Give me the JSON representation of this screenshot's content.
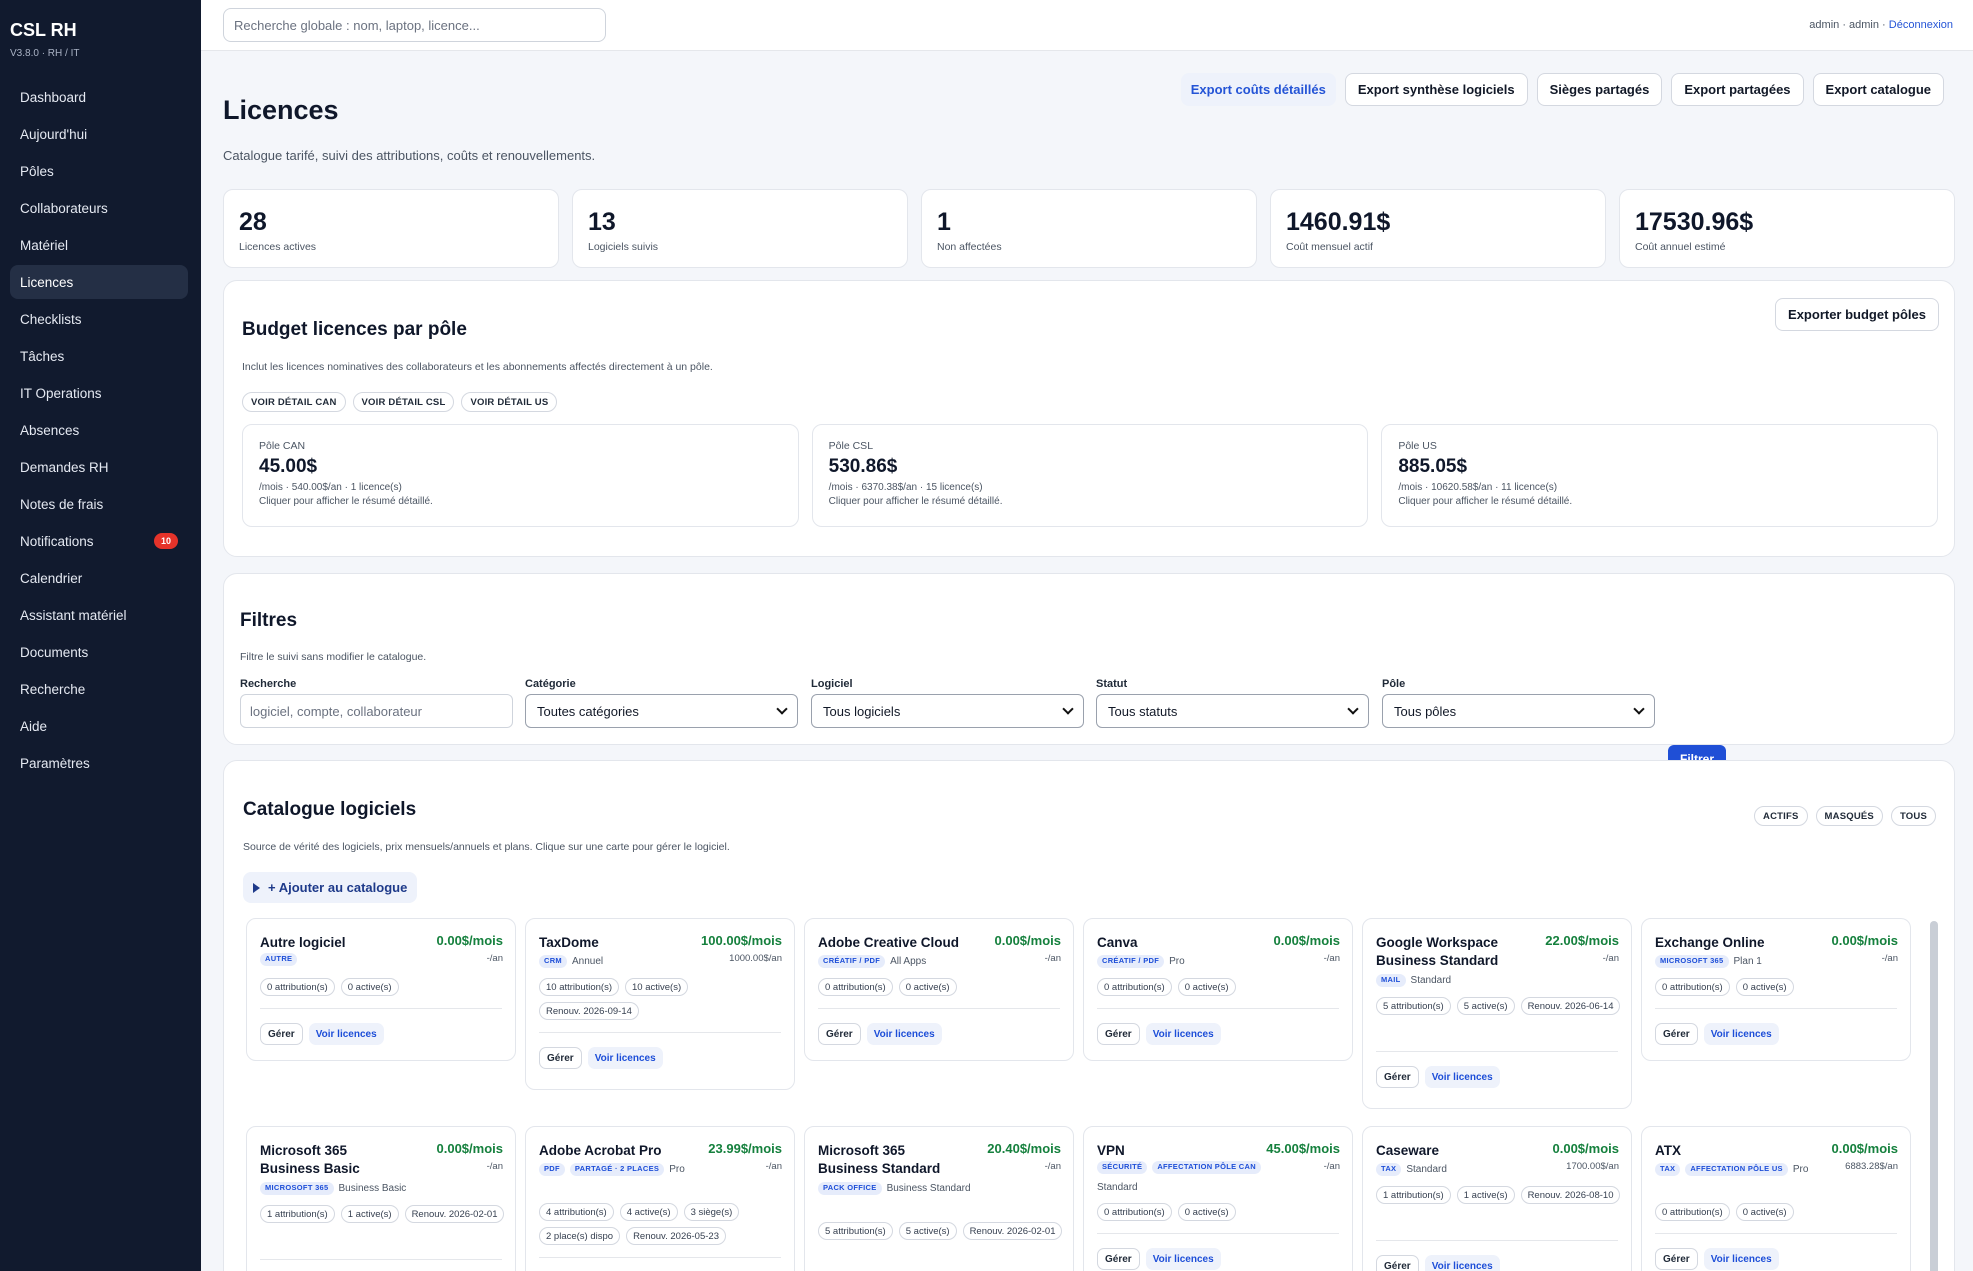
{
  "app": {
    "name": "CSL RH",
    "version": "V3.8.0 · RH / IT"
  },
  "sidebar": {
    "items": [
      {
        "label": "Dashboard"
      },
      {
        "label": "Aujourd'hui"
      },
      {
        "label": "Pôles"
      },
      {
        "label": "Collaborateurs"
      },
      {
        "label": "Matériel"
      },
      {
        "label": "Licences",
        "active": true
      },
      {
        "label": "Checklists"
      },
      {
        "label": "Tâches"
      },
      {
        "label": "IT Operations"
      },
      {
        "label": "Absences"
      },
      {
        "label": "Demandes RH"
      },
      {
        "label": "Notes de frais"
      },
      {
        "label": "Notifications",
        "badge": "10"
      },
      {
        "label": "Calendrier"
      },
      {
        "label": "Assistant matériel"
      },
      {
        "label": "Documents"
      },
      {
        "label": "Recherche"
      },
      {
        "label": "Aide"
      },
      {
        "label": "Paramètres"
      }
    ]
  },
  "topbar": {
    "search_placeholder": "Recherche globale : nom, laptop, licence...",
    "user": "admin · admin · ",
    "logout": "Déconnexion"
  },
  "header": {
    "title": "Licences",
    "subtitle": "Catalogue tarifé, suivi des attributions, coûts et renouvellements.",
    "actions": {
      "export_couts": "Export coûts détaillés",
      "export_synthese": "Export synthèse logiciels",
      "sieges": "Sièges partagés",
      "export_partagees": "Export partagées",
      "export_catalogue": "Export catalogue"
    }
  },
  "stats": [
    {
      "value": "28",
      "label": "Licences actives"
    },
    {
      "value": "13",
      "label": "Logiciels suivis"
    },
    {
      "value": "1",
      "label": "Non affectées"
    },
    {
      "value": "1460.91$",
      "label": "Coût mensuel actif"
    },
    {
      "value": "17530.96$",
      "label": "Coût annuel estimé"
    }
  ],
  "budget": {
    "title": "Budget licences par pôle",
    "note": "Inclut les licences nominatives des collaborateurs et les abonnements affectés directement à un pôle.",
    "export_label": "Exporter budget pôles",
    "chips": [
      "VOIR DÉTAIL CAN",
      "VOIR DÉTAIL CSL",
      "VOIR DÉTAIL US"
    ],
    "poles": [
      {
        "name": "Pôle CAN",
        "amount": "45.00$",
        "detail": "/mois · 540.00$/an · 1 licence(s)",
        "hint": "Cliquer pour afficher le résumé détaillé."
      },
      {
        "name": "Pôle CSL",
        "amount": "530.86$",
        "detail": "/mois · 6370.38$/an · 15 licence(s)",
        "hint": "Cliquer pour afficher le résumé détaillé."
      },
      {
        "name": "Pôle US",
        "amount": "885.05$",
        "detail": "/mois · 10620.58$/an · 11 licence(s)",
        "hint": "Cliquer pour afficher le résumé détaillé."
      }
    ]
  },
  "filters": {
    "title": "Filtres",
    "note": "Filtre le suivi sans modifier le catalogue.",
    "fields": {
      "search": {
        "label": "Recherche",
        "placeholder": "logiciel, compte, collaborateur"
      },
      "category": {
        "label": "Catégorie",
        "value": "Toutes catégories"
      },
      "software": {
        "label": "Logiciel",
        "value": "Tous logiciels"
      },
      "status": {
        "label": "Statut",
        "value": "Tous statuts"
      },
      "pole": {
        "label": "Pôle",
        "value": "Tous pôles"
      }
    },
    "submit": "Filtrer"
  },
  "catalog": {
    "title": "Catalogue logiciels",
    "note": "Source de vérité des logiciels, prix mensuels/annuels et plans. Clique sur une carte pour gérer le logiciel.",
    "toggles": [
      "ACTIFS",
      "MASQUÉS",
      "TOUS"
    ],
    "add_label": "+ Ajouter au catalogue",
    "manage_label": "Gérer",
    "view_label": "Voir licences",
    "cards": [
      {
        "name": "Autre logiciel",
        "price": "0.00$/mois",
        "annual": "-/an",
        "tags": [
          "AUTRE"
        ],
        "plan": "",
        "pills": [
          "0 attribution(s)",
          "0 active(s)"
        ]
      },
      {
        "name": "TaxDome",
        "price": "100.00$/mois",
        "annual": "1000.00$/an",
        "tags": [
          "CRM"
        ],
        "plan": "Annuel",
        "pills": [
          "10 attribution(s)",
          "10 active(s)",
          "Renouv. 2026-09-14"
        ]
      },
      {
        "name": "Adobe Creative Cloud",
        "price": "0.00$/mois",
        "annual": "-/an",
        "tags": [
          "CRÉATIF / PDF"
        ],
        "plan": "All Apps",
        "pills": [
          "0 attribution(s)",
          "0 active(s)"
        ]
      },
      {
        "name": "Canva",
        "price": "0.00$/mois",
        "annual": "-/an",
        "tags": [
          "CRÉATIF / PDF"
        ],
        "plan": "Pro",
        "pills": [
          "0 attribution(s)",
          "0 active(s)"
        ]
      },
      {
        "name": "Google Workspace Business Standard",
        "price": "22.00$/mois",
        "annual": "-/an",
        "tags": [
          "MAIL"
        ],
        "plan": "Standard",
        "pills": [
          "5 attribution(s)",
          "5 active(s)",
          "Renouv. 2026-06-14"
        ]
      },
      {
        "name": "Exchange Online",
        "price": "0.00$/mois",
        "annual": "-/an",
        "tags": [
          "MICROSOFT 365"
        ],
        "plan": "Plan 1",
        "pills": [
          "0 attribution(s)",
          "0 active(s)"
        ]
      },
      {
        "name": "Microsoft 365 Business Basic",
        "price": "0.00$/mois",
        "annual": "-/an",
        "tags": [
          "MICROSOFT 365"
        ],
        "plan": "Business Basic",
        "pills": [
          "1 attribution(s)",
          "1 active(s)",
          "Renouv. 2026-02-01"
        ]
      },
      {
        "name": "Adobe Acrobat Pro",
        "price": "23.99$/mois",
        "annual": "-/an",
        "tags": [
          "PDF",
          "PARTAGÉ · 2 PLACES"
        ],
        "plan": "Pro",
        "pills": [
          "4 attribution(s)",
          "4 active(s)",
          "3 siège(s)",
          "2 place(s) dispo",
          "Renouv. 2026-05-23"
        ]
      },
      {
        "name": "Microsoft 365 Business Standard",
        "price": "20.40$/mois",
        "annual": "-/an",
        "tags": [
          "PACK OFFICE"
        ],
        "plan": "Business Standard",
        "pills": [
          "5 attribution(s)",
          "5 active(s)",
          "Renouv. 2026-02-01"
        ]
      },
      {
        "name": "VPN",
        "price": "45.00$/mois",
        "annual": "-/an",
        "tags": [
          "SÉCURITÉ",
          "AFFECTATION PÔLE CAN"
        ],
        "plan": "Standard",
        "pills": [
          "0 attribution(s)",
          "0 active(s)"
        ]
      },
      {
        "name": "Caseware",
        "price": "0.00$/mois",
        "annual": "1700.00$/an",
        "tags": [
          "TAX"
        ],
        "plan": "Standard",
        "pills": [
          "1 attribution(s)",
          "1 active(s)",
          "Renouv. 2026-08-10"
        ]
      },
      {
        "name": "ATX",
        "price": "0.00$/mois",
        "annual": "6883.28$/an",
        "tags": [
          "TAX",
          "AFFECTATION PÔLE US"
        ],
        "plan": "Pro",
        "pills": [
          "0 attribution(s)",
          "0 active(s)"
        ]
      }
    ]
  }
}
